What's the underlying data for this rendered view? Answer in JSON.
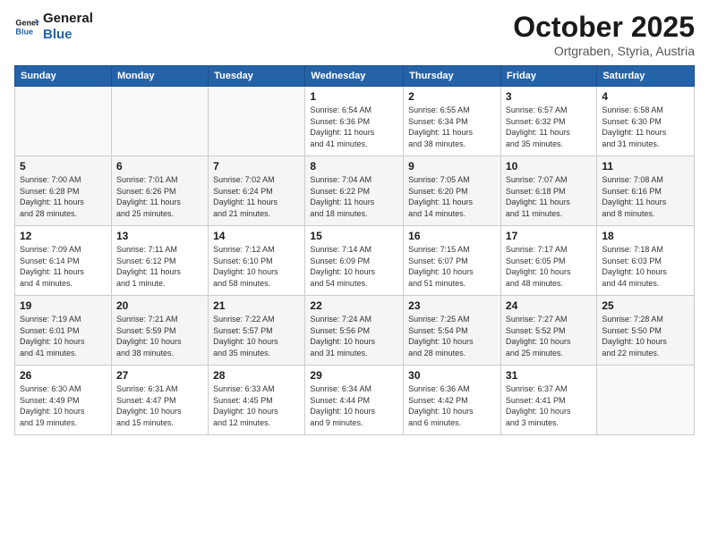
{
  "header": {
    "logo_line1": "General",
    "logo_line2": "Blue",
    "month": "October 2025",
    "location": "Ortgraben, Styria, Austria"
  },
  "days_of_week": [
    "Sunday",
    "Monday",
    "Tuesday",
    "Wednesday",
    "Thursday",
    "Friday",
    "Saturday"
  ],
  "weeks": [
    [
      {
        "num": "",
        "info": ""
      },
      {
        "num": "",
        "info": ""
      },
      {
        "num": "",
        "info": ""
      },
      {
        "num": "1",
        "info": "Sunrise: 6:54 AM\nSunset: 6:36 PM\nDaylight: 11 hours\nand 41 minutes."
      },
      {
        "num": "2",
        "info": "Sunrise: 6:55 AM\nSunset: 6:34 PM\nDaylight: 11 hours\nand 38 minutes."
      },
      {
        "num": "3",
        "info": "Sunrise: 6:57 AM\nSunset: 6:32 PM\nDaylight: 11 hours\nand 35 minutes."
      },
      {
        "num": "4",
        "info": "Sunrise: 6:58 AM\nSunset: 6:30 PM\nDaylight: 11 hours\nand 31 minutes."
      }
    ],
    [
      {
        "num": "5",
        "info": "Sunrise: 7:00 AM\nSunset: 6:28 PM\nDaylight: 11 hours\nand 28 minutes."
      },
      {
        "num": "6",
        "info": "Sunrise: 7:01 AM\nSunset: 6:26 PM\nDaylight: 11 hours\nand 25 minutes."
      },
      {
        "num": "7",
        "info": "Sunrise: 7:02 AM\nSunset: 6:24 PM\nDaylight: 11 hours\nand 21 minutes."
      },
      {
        "num": "8",
        "info": "Sunrise: 7:04 AM\nSunset: 6:22 PM\nDaylight: 11 hours\nand 18 minutes."
      },
      {
        "num": "9",
        "info": "Sunrise: 7:05 AM\nSunset: 6:20 PM\nDaylight: 11 hours\nand 14 minutes."
      },
      {
        "num": "10",
        "info": "Sunrise: 7:07 AM\nSunset: 6:18 PM\nDaylight: 11 hours\nand 11 minutes."
      },
      {
        "num": "11",
        "info": "Sunrise: 7:08 AM\nSunset: 6:16 PM\nDaylight: 11 hours\nand 8 minutes."
      }
    ],
    [
      {
        "num": "12",
        "info": "Sunrise: 7:09 AM\nSunset: 6:14 PM\nDaylight: 11 hours\nand 4 minutes."
      },
      {
        "num": "13",
        "info": "Sunrise: 7:11 AM\nSunset: 6:12 PM\nDaylight: 11 hours\nand 1 minute."
      },
      {
        "num": "14",
        "info": "Sunrise: 7:12 AM\nSunset: 6:10 PM\nDaylight: 10 hours\nand 58 minutes."
      },
      {
        "num": "15",
        "info": "Sunrise: 7:14 AM\nSunset: 6:09 PM\nDaylight: 10 hours\nand 54 minutes."
      },
      {
        "num": "16",
        "info": "Sunrise: 7:15 AM\nSunset: 6:07 PM\nDaylight: 10 hours\nand 51 minutes."
      },
      {
        "num": "17",
        "info": "Sunrise: 7:17 AM\nSunset: 6:05 PM\nDaylight: 10 hours\nand 48 minutes."
      },
      {
        "num": "18",
        "info": "Sunrise: 7:18 AM\nSunset: 6:03 PM\nDaylight: 10 hours\nand 44 minutes."
      }
    ],
    [
      {
        "num": "19",
        "info": "Sunrise: 7:19 AM\nSunset: 6:01 PM\nDaylight: 10 hours\nand 41 minutes."
      },
      {
        "num": "20",
        "info": "Sunrise: 7:21 AM\nSunset: 5:59 PM\nDaylight: 10 hours\nand 38 minutes."
      },
      {
        "num": "21",
        "info": "Sunrise: 7:22 AM\nSunset: 5:57 PM\nDaylight: 10 hours\nand 35 minutes."
      },
      {
        "num": "22",
        "info": "Sunrise: 7:24 AM\nSunset: 5:56 PM\nDaylight: 10 hours\nand 31 minutes."
      },
      {
        "num": "23",
        "info": "Sunrise: 7:25 AM\nSunset: 5:54 PM\nDaylight: 10 hours\nand 28 minutes."
      },
      {
        "num": "24",
        "info": "Sunrise: 7:27 AM\nSunset: 5:52 PM\nDaylight: 10 hours\nand 25 minutes."
      },
      {
        "num": "25",
        "info": "Sunrise: 7:28 AM\nSunset: 5:50 PM\nDaylight: 10 hours\nand 22 minutes."
      }
    ],
    [
      {
        "num": "26",
        "info": "Sunrise: 6:30 AM\nSunset: 4:49 PM\nDaylight: 10 hours\nand 19 minutes."
      },
      {
        "num": "27",
        "info": "Sunrise: 6:31 AM\nSunset: 4:47 PM\nDaylight: 10 hours\nand 15 minutes."
      },
      {
        "num": "28",
        "info": "Sunrise: 6:33 AM\nSunset: 4:45 PM\nDaylight: 10 hours\nand 12 minutes."
      },
      {
        "num": "29",
        "info": "Sunrise: 6:34 AM\nSunset: 4:44 PM\nDaylight: 10 hours\nand 9 minutes."
      },
      {
        "num": "30",
        "info": "Sunrise: 6:36 AM\nSunset: 4:42 PM\nDaylight: 10 hours\nand 6 minutes."
      },
      {
        "num": "31",
        "info": "Sunrise: 6:37 AM\nSunset: 4:41 PM\nDaylight: 10 hours\nand 3 minutes."
      },
      {
        "num": "",
        "info": ""
      }
    ]
  ],
  "colors": {
    "header_bg": "#2563a8",
    "header_text": "#ffffff",
    "accent": "#2563a8"
  }
}
